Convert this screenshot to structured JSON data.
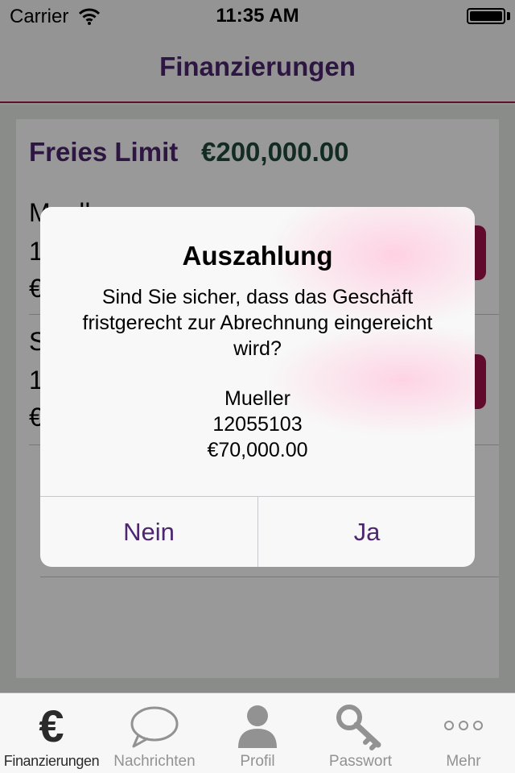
{
  "status_bar": {
    "carrier": "Carrier",
    "time": "11:35 AM"
  },
  "nav": {
    "title": "Finanzierungen"
  },
  "summary": {
    "limit_label": "Freies Limit",
    "limit_value": "€200,000.00"
  },
  "items": [
    {
      "name": "Mueller",
      "number": "1",
      "amount": "€"
    },
    {
      "name": "S",
      "number": "1",
      "amount": "€"
    }
  ],
  "alert": {
    "title": "Auszahlung",
    "message": "Sind Sie sicher, dass das Geschäft fristgerecht zur Abrechnung eingereicht wird?",
    "detail_name": "Mueller",
    "detail_number": "12055103",
    "detail_amount": "€70,000.00",
    "no_label": "Nein",
    "yes_label": "Ja"
  },
  "tabs": [
    {
      "label": "Finanzierungen",
      "icon": "euro-icon",
      "active": true
    },
    {
      "label": "Nachrichten",
      "icon": "speech-bubble-icon",
      "active": false
    },
    {
      "label": "Profil",
      "icon": "person-icon",
      "active": false
    },
    {
      "label": "Passwort",
      "icon": "key-icon",
      "active": false
    },
    {
      "label": "Mehr",
      "icon": "more-dots-icon",
      "active": false
    }
  ],
  "colors": {
    "brand_purple": "#4d2670",
    "accent_red": "#a4124a",
    "money_green": "#1f4a3d"
  }
}
